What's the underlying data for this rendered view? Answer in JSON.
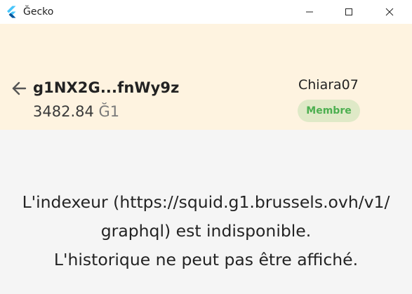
{
  "window": {
    "title": "Ğecko",
    "icons": {
      "app": "flutter-logo-icon",
      "minimize": "minimize-icon",
      "maximize": "maximize-icon",
      "close": "close-icon"
    }
  },
  "header": {
    "back_icon": "arrow-left-icon",
    "address": "g1NX2G...fnWy9z",
    "balance": {
      "amount": "3482.84",
      "unit": "Ğ1"
    },
    "username": "Chiara07",
    "badge": "Membre",
    "colors": {
      "background": "#fef3e0",
      "badge_bg": "#dfe9c7",
      "badge_text": "#4caf50"
    }
  },
  "message": {
    "lines": [
      "L'indexeur (https://squid.g1.brussels.ovh/v1/",
      "graphql) est indisponible.",
      "L'historique ne peut pas être affiché."
    ]
  }
}
